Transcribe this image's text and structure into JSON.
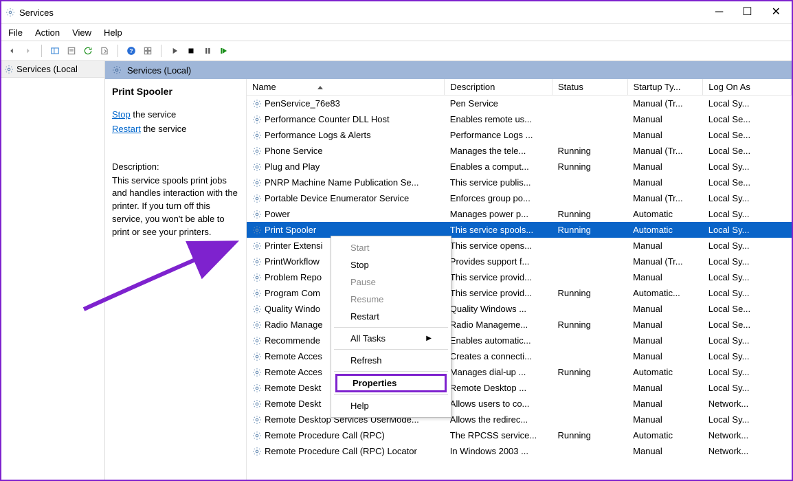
{
  "window": {
    "title": "Services"
  },
  "menu": {
    "file": "File",
    "action": "Action",
    "view": "View",
    "help": "Help"
  },
  "tree": {
    "root": "Services (Local"
  },
  "header": {
    "title": "Services (Local)"
  },
  "detail": {
    "name": "Print Spooler",
    "stop_link": "Stop",
    "stop_rest": " the service",
    "restart_link": "Restart",
    "restart_rest": " the service",
    "desc_label": "Description:",
    "desc": "This service spools print jobs and handles interaction with the printer.  If you turn off this service, you won't be able to print or see your printers."
  },
  "columns": {
    "name": "Name",
    "desc": "Description",
    "status": "Status",
    "startup": "Startup Ty...",
    "logon": "Log On As"
  },
  "services": [
    {
      "name": "PenService_76e83",
      "desc": "Pen Service",
      "status": "",
      "startup": "Manual (Tr...",
      "logon": "Local Sy..."
    },
    {
      "name": "Performance Counter DLL Host",
      "desc": "Enables remote us...",
      "status": "",
      "startup": "Manual",
      "logon": "Local Se..."
    },
    {
      "name": "Performance Logs & Alerts",
      "desc": "Performance Logs ...",
      "status": "",
      "startup": "Manual",
      "logon": "Local Se..."
    },
    {
      "name": "Phone Service",
      "desc": "Manages the tele...",
      "status": "Running",
      "startup": "Manual (Tr...",
      "logon": "Local Se..."
    },
    {
      "name": "Plug and Play",
      "desc": "Enables a comput...",
      "status": "Running",
      "startup": "Manual",
      "logon": "Local Sy..."
    },
    {
      "name": "PNRP Machine Name Publication Se...",
      "desc": "This service publis...",
      "status": "",
      "startup": "Manual",
      "logon": "Local Se..."
    },
    {
      "name": "Portable Device Enumerator Service",
      "desc": "Enforces group po...",
      "status": "",
      "startup": "Manual (Tr...",
      "logon": "Local Sy..."
    },
    {
      "name": "Power",
      "desc": "Manages power p...",
      "status": "Running",
      "startup": "Automatic",
      "logon": "Local Sy..."
    },
    {
      "name": "Print Spooler",
      "desc": "This service spools...",
      "status": "Running",
      "startup": "Automatic",
      "logon": "Local Sy...",
      "selected": true
    },
    {
      "name": "Printer Extensi",
      "desc": "This service opens...",
      "status": "",
      "startup": "Manual",
      "logon": "Local Sy..."
    },
    {
      "name": "PrintWorkflow",
      "desc": "Provides support f...",
      "status": "",
      "startup": "Manual (Tr...",
      "logon": "Local Sy..."
    },
    {
      "name": "Problem Repo",
      "desc": "This service provid...",
      "status": "",
      "startup": "Manual",
      "logon": "Local Sy..."
    },
    {
      "name": "Program Com",
      "desc": "This service provid...",
      "status": "Running",
      "startup": "Automatic...",
      "logon": "Local Sy..."
    },
    {
      "name": "Quality Windo",
      "desc": "Quality Windows ...",
      "status": "",
      "startup": "Manual",
      "logon": "Local Se..."
    },
    {
      "name": "Radio Manage",
      "desc": "Radio Manageme...",
      "status": "Running",
      "startup": "Manual",
      "logon": "Local Se..."
    },
    {
      "name": "Recommende",
      "desc": "Enables automatic...",
      "status": "",
      "startup": "Manual",
      "logon": "Local Sy..."
    },
    {
      "name": "Remote Acces",
      "desc": "Creates a connecti...",
      "status": "",
      "startup": "Manual",
      "logon": "Local Sy..."
    },
    {
      "name": "Remote Acces",
      "desc": "Manages dial-up ...",
      "status": "Running",
      "startup": "Automatic",
      "logon": "Local Sy..."
    },
    {
      "name": "Remote Deskt",
      "desc": "Remote Desktop ...",
      "status": "",
      "startup": "Manual",
      "logon": "Local Sy..."
    },
    {
      "name": "Remote Deskt",
      "desc": "Allows users to co...",
      "status": "",
      "startup": "Manual",
      "logon": "Network..."
    },
    {
      "name": "Remote Desktop Services UserMode...",
      "desc": "Allows the redirec...",
      "status": "",
      "startup": "Manual",
      "logon": "Local Sy..."
    },
    {
      "name": "Remote Procedure Call (RPC)",
      "desc": "The RPCSS service...",
      "status": "Running",
      "startup": "Automatic",
      "logon": "Network..."
    },
    {
      "name": "Remote Procedure Call (RPC) Locator",
      "desc": "In Windows 2003 ...",
      "status": "",
      "startup": "Manual",
      "logon": "Network..."
    }
  ],
  "context_menu": {
    "start": "Start",
    "stop": "Stop",
    "pause": "Pause",
    "resume": "Resume",
    "restart": "Restart",
    "all_tasks": "All Tasks",
    "refresh": "Refresh",
    "properties": "Properties",
    "help": "Help"
  }
}
